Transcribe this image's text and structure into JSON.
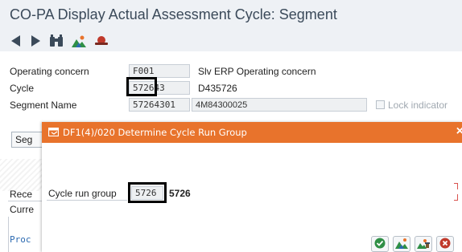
{
  "window": {
    "title": "CO-PA Display Actual Assessment Cycle: Segment"
  },
  "toolbar": {
    "icons": [
      "back-arrow-icon",
      "forward-arrow-icon",
      "binoculars-icon",
      "landscape-icon",
      "hat-icon"
    ]
  },
  "form": {
    "operating_concern": {
      "label": "Operating concern",
      "value": "F001",
      "text": "Slv ERP Operating concern"
    },
    "cycle": {
      "label": "Cycle",
      "value": "572643",
      "text": "D435726"
    },
    "segment": {
      "label": "Segment Name",
      "value": "57264301",
      "text": "4M84300025"
    },
    "lock_indicator": {
      "label": "Lock indicator",
      "checked": false
    }
  },
  "background": {
    "tab_stub": "Seg",
    "receiver_stub": "Rece",
    "currency_stub": "Curre",
    "proc_stub": "Proc"
  },
  "dialog": {
    "title": "DF1(4)/020 Determine Cycle Run Group",
    "close_label": "×",
    "field_label": "Cycle run group",
    "field_value": "5726",
    "field_text": "5726",
    "buttons": [
      "confirm-check-icon",
      "landscape-icon",
      "tools-icon",
      "cancel-icon"
    ]
  },
  "colors": {
    "dialog_title_bg": "#e8732c",
    "window_bg": "#eef1f5",
    "highlight_border": "#000000"
  }
}
